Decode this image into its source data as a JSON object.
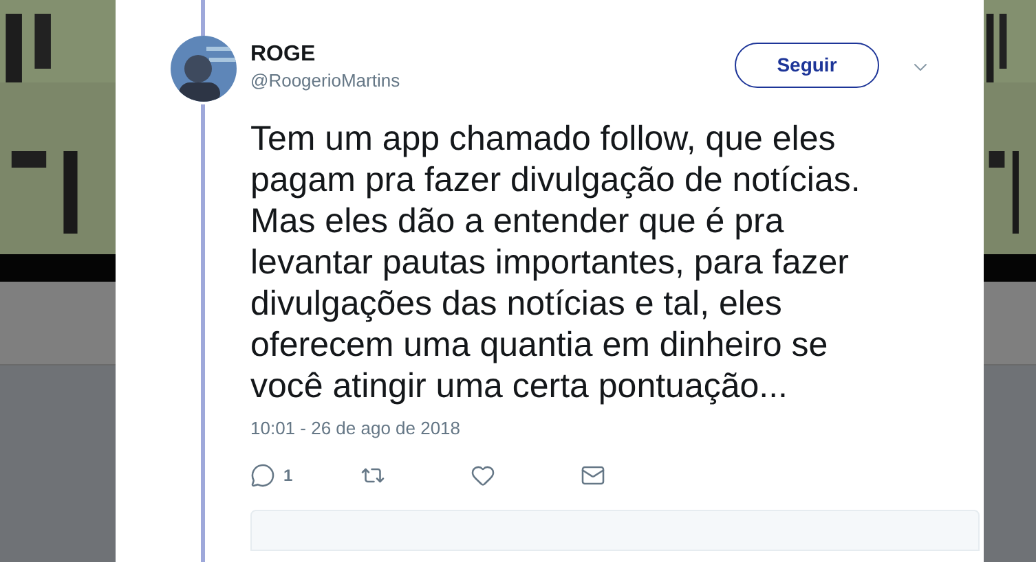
{
  "tweet": {
    "name": "ROGE",
    "handle": "@RoogerioMartins",
    "follow_button": "Seguir",
    "text": "Tem um app chamado follow, que eles\npagam pra fazer divulgação de notícias.\nMas eles dão a entender que é pra\nlevantar pautas importantes, para fazer\ndivulgações das notícias e tal, eles\noferecem uma quantia em dinheiro se\nvocê atingir uma certa pontuação...",
    "timestamp": "10:01 - 26 de ago de 2018",
    "actions": [
      {
        "kind": "reply",
        "count": "1"
      },
      {
        "kind": "retweet"
      },
      {
        "kind": "like"
      },
      {
        "kind": "message"
      }
    ]
  }
}
